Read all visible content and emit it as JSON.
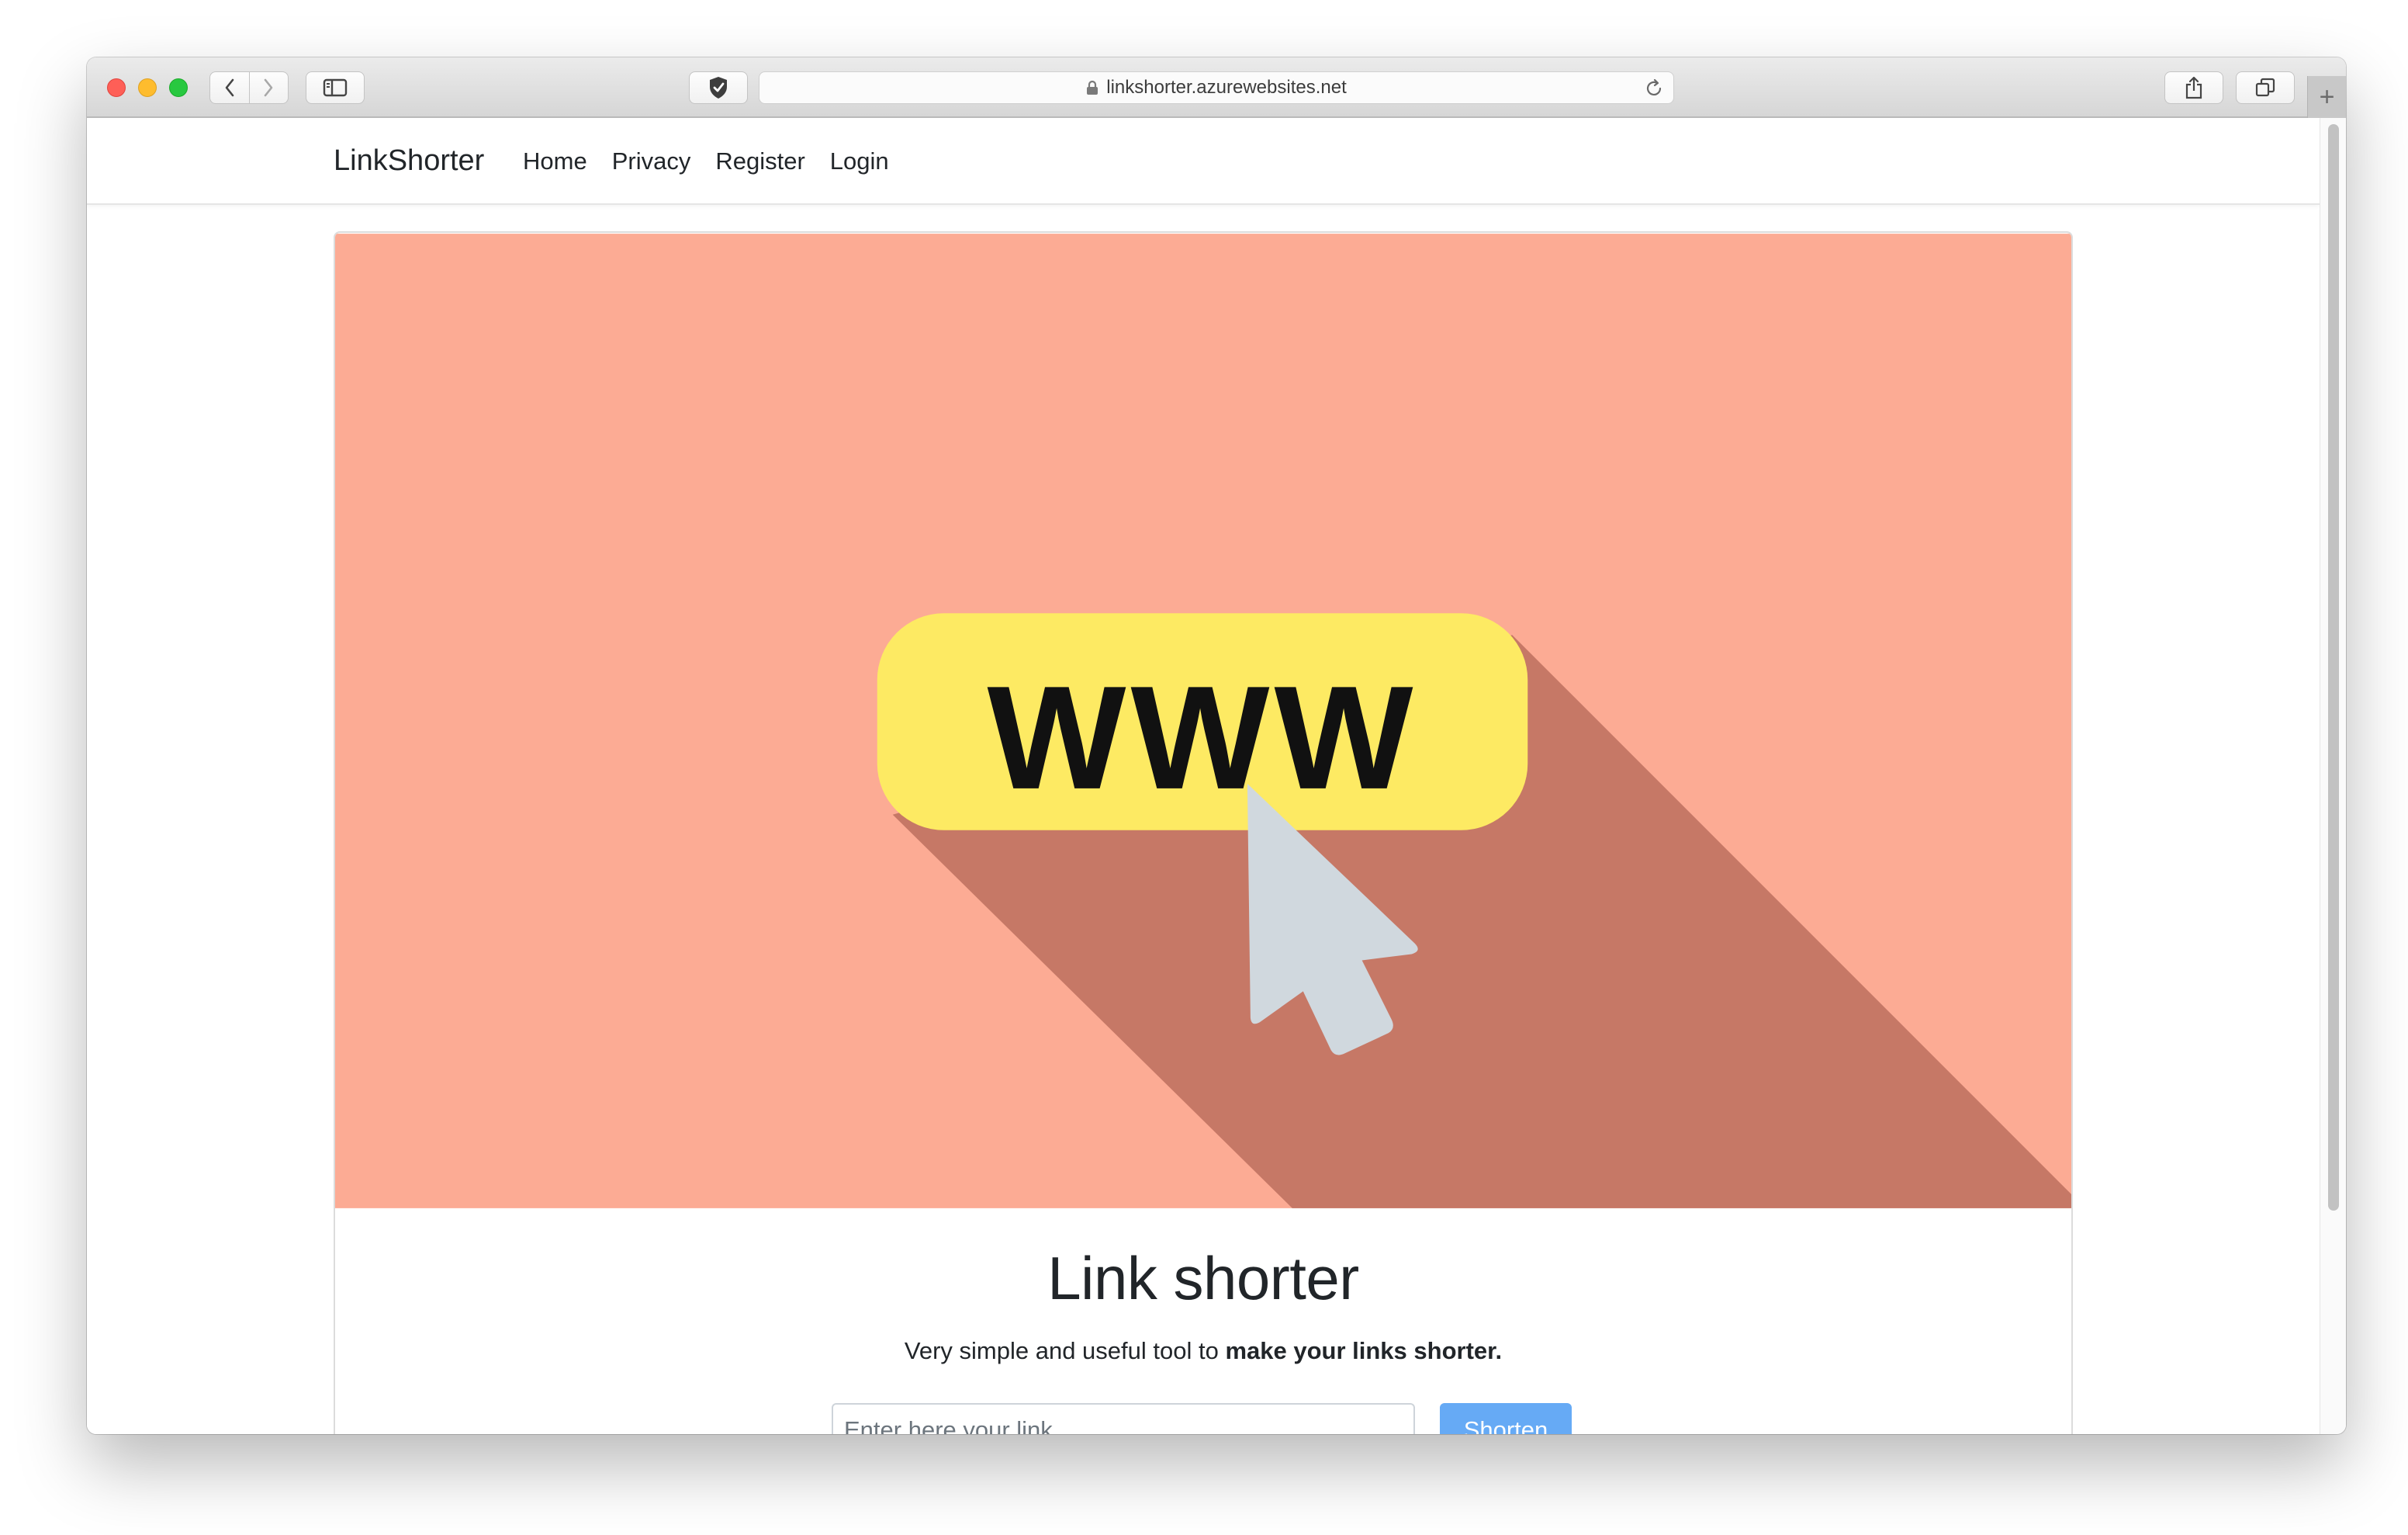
{
  "browser": {
    "url": "linkshorter.azurewebsites.net"
  },
  "site": {
    "brand": "LinkShorter",
    "nav": {
      "home": "Home",
      "privacy": "Privacy",
      "register": "Register",
      "login": "Login"
    }
  },
  "hero": {
    "badge_text": "WWW",
    "colors": {
      "background": "#fcab94",
      "shadow": "#c67866",
      "badge": "#fdea63",
      "cursor": "#d0d8de"
    }
  },
  "main": {
    "title": "Link shorter",
    "subtitle_plain": "Very simple and useful tool to ",
    "subtitle_bold": "make your links shorter.",
    "input_placeholder": "Enter here your link",
    "button_label": "Shorten"
  }
}
